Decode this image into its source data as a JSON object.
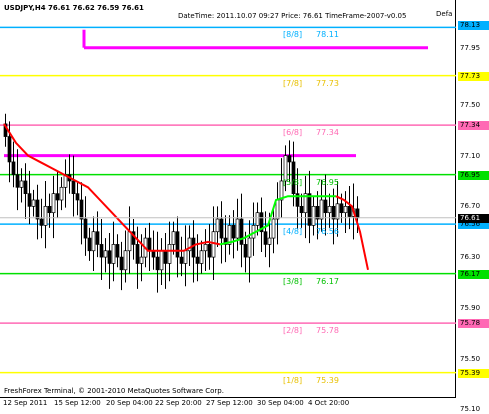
{
  "window": {
    "symbol_header": "USDJPY,H4  76.61 76.62 76.59 76.61",
    "info_text": "DateTime: 2011.10.07 09:27  Price: 76.61  TimeFrame-2007-v0.05",
    "default_label": "Defa",
    "copyright": "FreshForex Terminal, © 2001-2010 MetaQuotes Software Corp."
  },
  "colors": {
    "background": "#ffffff",
    "candles": "#000000",
    "murrey_0": "#00b0ff",
    "murrey_1": "#ff00ff",
    "murrey_yellow": "#ffff00",
    "murrey_pink": "#ff69b4",
    "murrey_green": "#00e000",
    "ma_red": "#ff0000",
    "ma_green": "#00ff00",
    "bid_line": "#c0c0c0",
    "current_label_bg": "#000000"
  },
  "murrey_levels": [
    {
      "id": "8-8",
      "fraction": "[8/8]",
      "value": "78.11",
      "price": 78.11,
      "color": "#00b0ff",
      "label_color": "#00b0ff"
    },
    {
      "id": "7-8",
      "fraction": "[7/8]",
      "value": "77.73",
      "price": 77.73,
      "color": "#ffff00",
      "label_color": "#e8c000"
    },
    {
      "id": "6-8",
      "fraction": "[6/8]",
      "value": "77.34",
      "price": 77.34,
      "color": "#ff69b4",
      "label_color": "#ff69b4"
    },
    {
      "id": "5-8",
      "fraction": "[5/8]",
      "value": "76.95",
      "price": 76.95,
      "color": "#00e000",
      "label_color": "#00c000"
    },
    {
      "id": "4-8",
      "fraction": "[4/8]",
      "value": "76.56",
      "price": 76.56,
      "color": "#00b0ff",
      "label_color": "#00b0ff"
    },
    {
      "id": "3-8",
      "fraction": "[3/8]",
      "value": "76.17",
      "price": 76.17,
      "color": "#00e000",
      "label_color": "#00c000"
    },
    {
      "id": "2-8",
      "fraction": "[2/8]",
      "value": "75.78",
      "price": 75.78,
      "color": "#ff69b4",
      "label_color": "#ff69b4"
    },
    {
      "id": "1-8",
      "fraction": "[1/8]",
      "value": "75.39",
      "price": 75.39,
      "color": "#ffff00",
      "label_color": "#e8c000"
    }
  ],
  "price_axis": {
    "tick_labels": [
      "77.95",
      "77.50",
      "77.10",
      "76.70",
      "76.30",
      "75.90",
      "75.50",
      "75.10"
    ],
    "tick_values": [
      77.95,
      77.5,
      77.1,
      76.7,
      76.3,
      75.9,
      75.5,
      75.1
    ],
    "level_markers": [
      {
        "text": "78.13",
        "price": 78.13,
        "bg": "#00b0ff"
      },
      {
        "text": "77.73",
        "price": 77.73,
        "bg": "#ffff00"
      },
      {
        "text": "77.34",
        "price": 77.34,
        "bg": "#ff69b4"
      },
      {
        "text": "76.95",
        "price": 76.95,
        "bg": "#00e000"
      },
      {
        "text": "76.56",
        "price": 76.56,
        "bg": "#00b0ff"
      },
      {
        "text": "76.17",
        "price": 76.17,
        "bg": "#00e000"
      },
      {
        "text": "75.78",
        "price": 75.78,
        "bg": "#ff69b4"
      },
      {
        "text": "75.39",
        "price": 75.39,
        "bg": "#ffff00"
      }
    ],
    "current_price": {
      "text": "76.61",
      "price": 76.61
    }
  },
  "time_axis": {
    "labels": [
      "12 Sep 2011",
      "15 Sep 12:00",
      "20 Sep 04:00",
      "22 Sep 20:00",
      "27 Sep 12:00",
      "30 Sep 04:00",
      "4 Oct 20:00"
    ]
  },
  "chart_data": {
    "type": "candlestick",
    "symbol": "USDJPY",
    "timeframe": "H4",
    "ylim": [
      75.3,
      78.2
    ],
    "last": {
      "open": 76.61,
      "high": 76.62,
      "low": 76.59,
      "close": 76.61
    },
    "closes": [
      77.25,
      77.05,
      76.95,
      76.85,
      76.9,
      76.8,
      76.7,
      76.75,
      76.6,
      76.55,
      76.7,
      76.65,
      76.8,
      76.75,
      76.85,
      76.95,
      76.9,
      76.8,
      76.75,
      76.6,
      76.45,
      76.35,
      76.5,
      76.4,
      76.3,
      76.35,
      76.25,
      76.4,
      76.3,
      76.2,
      76.35,
      76.5,
      76.4,
      76.25,
      76.3,
      76.45,
      76.35,
      76.3,
      76.2,
      76.35,
      76.25,
      76.4,
      76.5,
      76.3,
      76.25,
      76.35,
      76.45,
      76.3,
      76.25,
      76.35,
      76.4,
      76.3,
      76.5,
      76.6,
      76.45,
      76.4,
      76.55,
      76.45,
      76.6,
      76.4,
      76.3,
      76.45,
      76.55,
      76.65,
      76.5,
      76.4,
      76.45,
      76.6,
      76.75,
      76.9,
      77.1,
      77.05,
      76.8,
      76.7,
      76.65,
      76.8,
      76.55,
      76.7,
      76.6,
      76.75,
      76.65,
      76.7,
      76.6,
      76.72,
      76.65,
      76.7,
      76.62,
      76.68,
      76.61
    ],
    "ma_segments": [
      {
        "color": "#ff0000",
        "points": [
          [
            0,
            77.35
          ],
          [
            3,
            77.2
          ],
          [
            6,
            77.1
          ],
          [
            9,
            77.05
          ],
          [
            12,
            77.0
          ],
          [
            15,
            76.95
          ],
          [
            18,
            76.9
          ],
          [
            21,
            76.85
          ],
          [
            24,
            76.75
          ],
          [
            27,
            76.65
          ],
          [
            30,
            76.55
          ],
          [
            33,
            76.45
          ],
          [
            36,
            76.35
          ],
          [
            39,
            76.35
          ],
          [
            42,
            76.35
          ],
          [
            45,
            76.35
          ],
          [
            48,
            76.4
          ],
          [
            51,
            76.42
          ],
          [
            54,
            76.4
          ]
        ]
      },
      {
        "color": "#00ff00",
        "points": [
          [
            54,
            76.4
          ],
          [
            57,
            76.42
          ],
          [
            60,
            76.45
          ],
          [
            63,
            76.5
          ],
          [
            66,
            76.55
          ],
          [
            68,
            76.75
          ],
          [
            71,
            76.78
          ],
          [
            74,
            76.78
          ],
          [
            77,
            76.78
          ],
          [
            80,
            76.78
          ],
          [
            83,
            76.78
          ]
        ]
      },
      {
        "color": "#ff0000",
        "points": [
          [
            83,
            76.78
          ],
          [
            85,
            76.75
          ],
          [
            87,
            76.7
          ],
          [
            89,
            76.5
          ],
          [
            91,
            76.2
          ]
        ]
      }
    ],
    "magenta_lines": [
      {
        "price": 77.1,
        "from": 0,
        "to": 88
      },
      {
        "price": 77.95,
        "from": 20,
        "to": 106
      }
    ]
  }
}
